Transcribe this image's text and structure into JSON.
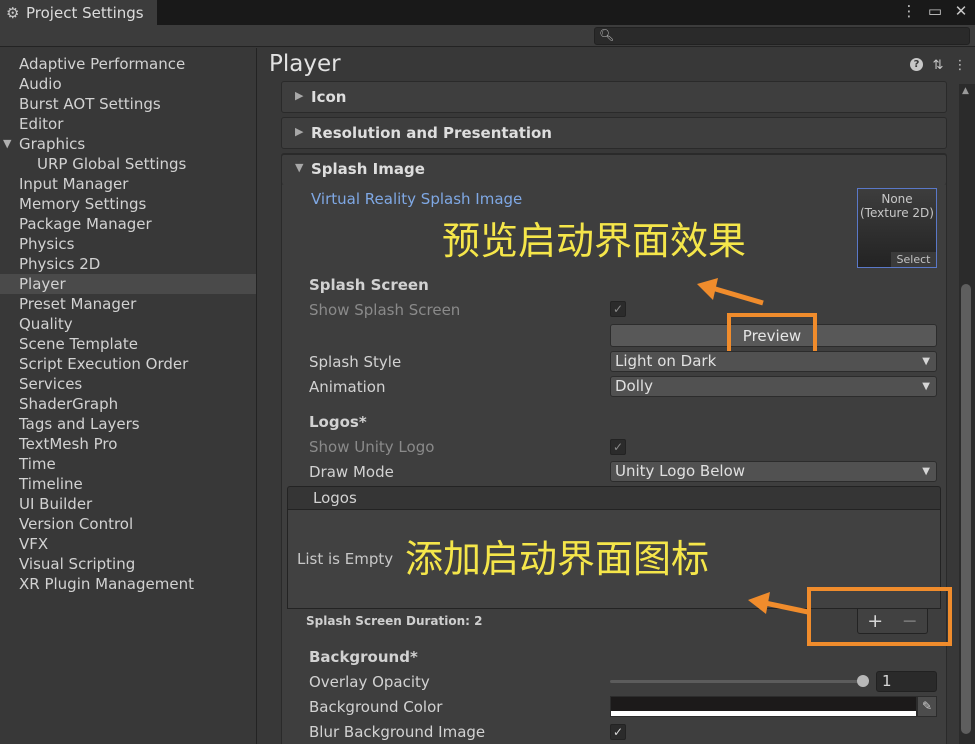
{
  "window": {
    "tab_title": "Project Settings",
    "icons": [
      "more-vert-icon",
      "maximize-icon",
      "close-icon"
    ]
  },
  "search": {
    "value": ""
  },
  "sidebar": {
    "items": [
      {
        "label": "Adaptive Performance"
      },
      {
        "label": "Audio"
      },
      {
        "label": "Burst AOT Settings"
      },
      {
        "label": "Editor"
      },
      {
        "label": "Graphics",
        "expanded": true
      },
      {
        "label": "URP Global Settings",
        "child": true
      },
      {
        "label": "Input Manager"
      },
      {
        "label": "Memory Settings"
      },
      {
        "label": "Package Manager"
      },
      {
        "label": "Physics"
      },
      {
        "label": "Physics 2D"
      },
      {
        "label": "Player",
        "selected": true
      },
      {
        "label": "Preset Manager"
      },
      {
        "label": "Quality"
      },
      {
        "label": "Scene Template"
      },
      {
        "label": "Script Execution Order"
      },
      {
        "label": "Services"
      },
      {
        "label": "ShaderGraph"
      },
      {
        "label": "Tags and Layers"
      },
      {
        "label": "TextMesh Pro"
      },
      {
        "label": "Time"
      },
      {
        "label": "Timeline"
      },
      {
        "label": "UI Builder"
      },
      {
        "label": "Version Control"
      },
      {
        "label": "VFX"
      },
      {
        "label": "Visual Scripting"
      },
      {
        "label": "XR Plugin Management"
      }
    ]
  },
  "main": {
    "title": "Player",
    "sections": {
      "icon": "Icon",
      "resolution": "Resolution and Presentation",
      "splash": "Splash Image"
    },
    "vr_splash_link": "Virtual Reality Splash Image",
    "texture_field": {
      "line1": "None",
      "line2": "(Texture 2D)",
      "select": "Select"
    },
    "splash_screen": {
      "heading": "Splash Screen",
      "show_splash_label": "Show Splash Screen",
      "show_splash_checked": true,
      "preview_label": "Preview",
      "splash_style_label": "Splash Style",
      "splash_style_value": "Light on Dark",
      "animation_label": "Animation",
      "animation_value": "Dolly"
    },
    "logos": {
      "heading": "Logos*",
      "show_unity_logo_label": "Show Unity Logo",
      "show_unity_logo_checked": true,
      "draw_mode_label": "Draw Mode",
      "draw_mode_value": "Unity Logo Below",
      "list_header": "Logos",
      "list_empty": "List is Empty",
      "add": "+",
      "remove": "−",
      "duration": "Splash Screen Duration: 2"
    },
    "background": {
      "heading": "Background*",
      "overlay_opacity_label": "Overlay Opacity",
      "overlay_opacity_value": "1",
      "background_color_label": "Background Color",
      "background_color": "#1c1a1a",
      "blur_label": "Blur Background Image",
      "blur_checked": true
    }
  },
  "annotations": {
    "preview_note": "预览启动界面效果",
    "logo_note": "添加启动界面图标",
    "highlight_color": "#f08c2c",
    "text_color": "#f5e64a"
  }
}
